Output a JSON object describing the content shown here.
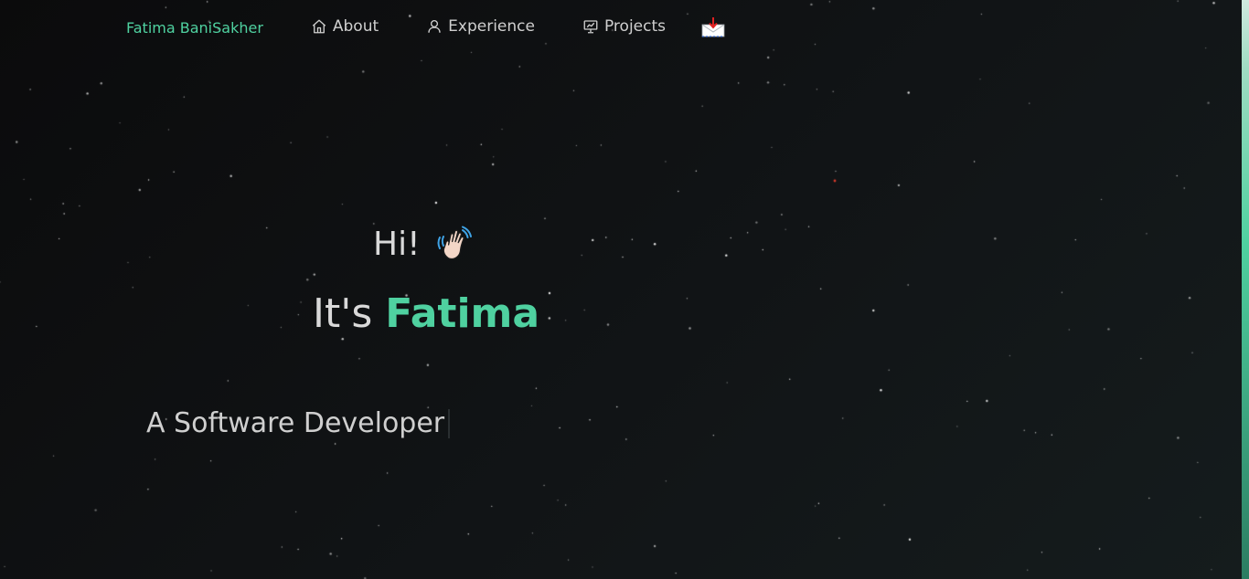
{
  "nav": {
    "brand": "Fatima BaniSakher",
    "items": [
      {
        "label": "About",
        "icon": "home-icon"
      },
      {
        "label": "Experience",
        "icon": "user-icon"
      },
      {
        "label": "Projects",
        "icon": "presentation-icon"
      }
    ],
    "mail_icon": "mail-download-icon"
  },
  "hero": {
    "greeting": "Hi!",
    "wave_icon": "waving-hand-icon",
    "name_prefix": "It's",
    "name": "Fatima",
    "role": "A Software Developer"
  },
  "colors": {
    "accent": "#4fd1a0",
    "background": "#111416",
    "text": "#d9d9d9"
  }
}
